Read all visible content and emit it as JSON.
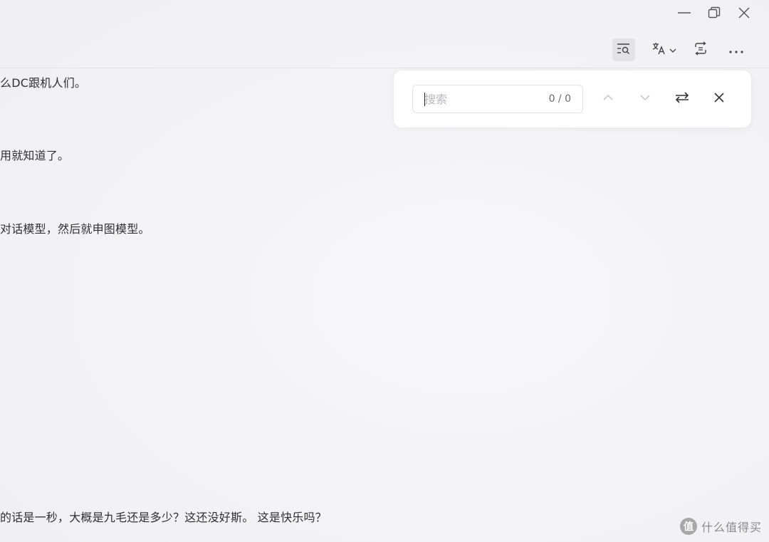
{
  "window_controls": {
    "minimize_icon": "minimize-icon",
    "restore_icon": "restore-icon",
    "close_icon": "close-icon"
  },
  "toolbar": {
    "buttons": [
      {
        "icon": "search-text-icon",
        "active": true
      },
      {
        "icon": "translate-icon",
        "dropdown": true
      },
      {
        "icon": "swap-format-icon"
      },
      {
        "icon": "more-icon"
      }
    ]
  },
  "transcript": {
    "lines": [
      "么DC跟机人们。",
      "用就知道了。",
      "对话模型，然后就申图模型。",
      "的话是一秒，大概是九毛还是多少？这还没好斯。 这是快乐吗？"
    ]
  },
  "search": {
    "placeholder": "搜索",
    "value": "",
    "match_count": "0 / 0"
  },
  "watermark": {
    "logo_text": "值",
    "text": "什么值得买"
  },
  "colors": {
    "background": "#f4f4f6",
    "panel": "#ffffff",
    "text": "#303030",
    "muted": "#b8b8bc",
    "active_tool_bg": "#e3e3e6"
  }
}
